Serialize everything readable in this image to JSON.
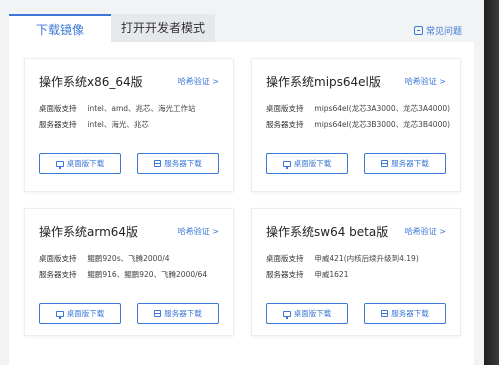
{
  "tabs": [
    {
      "label": "下载镜像",
      "active": true
    },
    {
      "label": "打开开发者模式",
      "active": false
    }
  ],
  "faq_link": "常见问题",
  "row_labels": {
    "desktop": "桌面版支持",
    "server": "服务器支持"
  },
  "buttons": {
    "desktop": "桌面版下载",
    "server": "服务器下载"
  },
  "cards": [
    {
      "title": "操作系统x86_64版",
      "verify": "哈希验证 >",
      "desktop": "intel、amd、兆芯、海光工作站",
      "server": "intel、海光、兆芯"
    },
    {
      "title": "操作系统mips64el版",
      "verify": "哈希验证 >",
      "desktop": "mips64el(龙芯3A3000、龙芯3A4000)",
      "server": "mips64el(龙芯3B3000、龙芯3B4000)"
    },
    {
      "title": "操作系统arm64版",
      "verify": "哈希验证 >",
      "desktop": "鲲鹏920s、飞腾2000/4",
      "server": "鲲鹏916、鲲鹏920、飞腾2000/64"
    },
    {
      "title": "操作系统sw64 beta版",
      "verify": "哈希验证 >",
      "desktop": "申威421(内核后续升级到4.19)",
      "server": "申威1621"
    }
  ],
  "colors": {
    "accent": "#3b78d8",
    "background": "#f2f3f5"
  }
}
